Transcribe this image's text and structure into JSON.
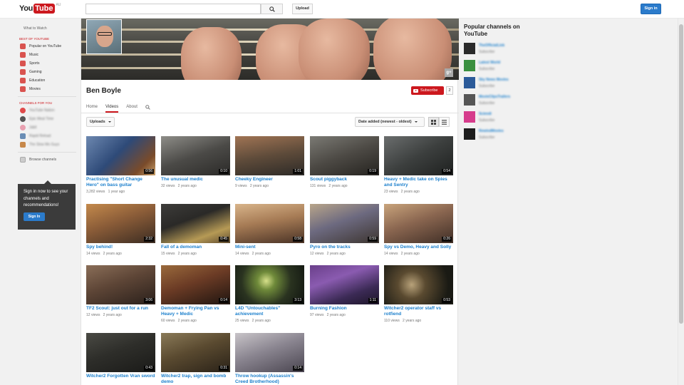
{
  "header": {
    "logo": {
      "you": "You",
      "tube": "Tube",
      "region": "AU"
    },
    "search_placeholder": "",
    "upload_label": "Upload",
    "signin_label": "Sign in"
  },
  "guide": {
    "what_to_watch": "What to Watch",
    "best_heading": "BEST OF YOUTUBE",
    "best_items": [
      {
        "label": "Popular on YouTube",
        "icon": "popular-icon"
      },
      {
        "label": "Music",
        "icon": "music-icon"
      },
      {
        "label": "Sports",
        "icon": "sports-icon"
      },
      {
        "label": "Gaming",
        "icon": "gaming-icon"
      },
      {
        "label": "Education",
        "icon": "education-icon"
      },
      {
        "label": "Movies",
        "icon": "movies-icon"
      }
    ],
    "channels_heading": "CHANNELS FOR YOU",
    "channel_items": [
      "YouTube Nation",
      "Epic Meal Time",
      "Jabil",
      "Rapid Reload",
      "The Slow Mo Guys"
    ],
    "browse_label": "Browse channels",
    "signin_prompt": "Sign in now to see your channels and recommendations!",
    "signin_button": "Sign In"
  },
  "channel": {
    "name": "Ben Boyle",
    "subscribe_label": "Subscribe",
    "subscriber_count": "2",
    "gplus_label": "g+",
    "tabs": [
      {
        "label": "Home",
        "active": false
      },
      {
        "label": "Videos",
        "active": true
      },
      {
        "label": "About",
        "active": false
      }
    ],
    "uploads_label": "Uploads",
    "sort_label": "Date added (newest - oldest)"
  },
  "videos": [
    {
      "title": "Practising \"Short Change Hero\" on bass guitar",
      "views": "3,282 views",
      "age": "1 year ago",
      "duration": "0:56"
    },
    {
      "title": "The unusual medic",
      "views": "32 views",
      "age": "2 years ago",
      "duration": "0:10"
    },
    {
      "title": "Cheeky Engineer",
      "views": "9 views",
      "age": "2 years ago",
      "duration": "1:01"
    },
    {
      "title": "Scout piggyback",
      "views": "131 views",
      "age": "2 years ago",
      "duration": "0:19"
    },
    {
      "title": "Heavy + Medic take on Spies and Sentry",
      "views": "23 views",
      "age": "2 years ago",
      "duration": "0:54"
    },
    {
      "title": "Spy behind!",
      "views": "14 views",
      "age": "2 years ago",
      "duration": "2:32"
    },
    {
      "title": "Fall of a demoman",
      "views": "15 views",
      "age": "2 years ago",
      "duration": "0:45"
    },
    {
      "title": "Mini-sent",
      "views": "14 views",
      "age": "2 years ago",
      "duration": "0:58"
    },
    {
      "title": "Pyro on the tracks",
      "views": "12 views",
      "age": "2 years ago",
      "duration": "0:59"
    },
    {
      "title": "Spy vs Demo, Heavy and Solly",
      "views": "14 views",
      "age": "2 years ago",
      "duration": "0:26"
    },
    {
      "title": "TF2 Scout: just out for a run",
      "views": "12 views",
      "age": "2 years ago",
      "duration": "3:06"
    },
    {
      "title": "Demoman + Frying Pan vs Heavy + Medic",
      "views": "60 views",
      "age": "2 years ago",
      "duration": "0:14"
    },
    {
      "title": "L4D \"Untouchables\" achievement",
      "views": "25 views",
      "age": "2 years ago",
      "duration": "3:13"
    },
    {
      "title": "Burning Fashion",
      "views": "97 views",
      "age": "2 years ago",
      "duration": "1:11"
    },
    {
      "title": "Witcher2 operator staff vs rotfiend",
      "views": "110 views",
      "age": "2 years ago",
      "duration": "0:53"
    },
    {
      "title": "Witcher2 Forgotten Vran sword",
      "views": "",
      "age": "",
      "duration": "0:43"
    },
    {
      "title": "Witcher2 trap, sign and bomb demo",
      "views": "",
      "age": "",
      "duration": "0:31"
    },
    {
      "title": "Throw hookup (Assassin's Creed Brotherhood)",
      "views": "",
      "age": "",
      "duration": "0:14"
    }
  ],
  "popular": {
    "heading": "Popular channels on YouTube",
    "channels": [
      {
        "name": "TheOfficialLink",
        "sub": "Subscribe",
        "color": "#2a2a2a"
      },
      {
        "name": "Latest World",
        "sub": "Subscribe",
        "color": "#3a8f3f"
      },
      {
        "name": "Sky News Movies",
        "sub": "Subscribe",
        "color": "#2b5a99"
      },
      {
        "name": "MovieClipsTrailers",
        "sub": "Subscribe",
        "color": "#555555"
      },
      {
        "name": "Sciendi",
        "sub": "Subscribe",
        "color": "#d63c8c"
      },
      {
        "name": "RewindMovies",
        "sub": "Subscribe",
        "color": "#1d1d1d"
      }
    ]
  }
}
